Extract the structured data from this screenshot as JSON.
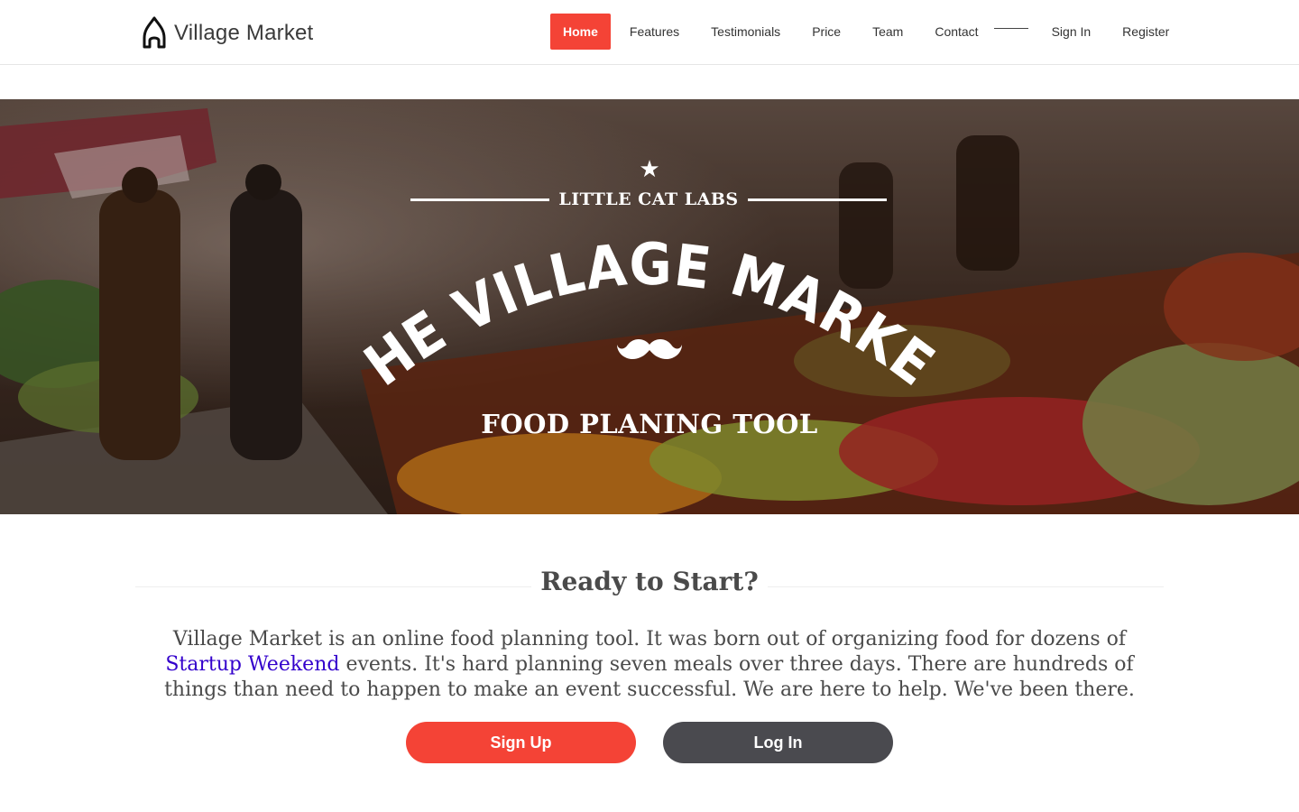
{
  "header": {
    "brand_name": "Village Market",
    "nav": [
      {
        "label": "Home",
        "active": true
      },
      {
        "label": "Features",
        "active": false
      },
      {
        "label": "Testimonials",
        "active": false
      },
      {
        "label": "Price",
        "active": false
      },
      {
        "label": "Team",
        "active": false
      },
      {
        "label": "Contact",
        "active": false
      }
    ],
    "auth": [
      {
        "label": "Sign In"
      },
      {
        "label": "Register"
      }
    ]
  },
  "hero": {
    "star_icon": "★",
    "kicker": "LITTLE CAT LABS",
    "title": "THE VILLAGE MARKET",
    "tagline": "FOOD PLANING TOOL",
    "mustache_icon": "mustache-icon",
    "background": "market-photo"
  },
  "ready": {
    "title": "Ready to Start?",
    "intro_before": "Village Market is an online food planning tool. It was born out of organizing food for dozens of ",
    "intro_link": "Startup Weekend",
    "intro_after": " events. It's hard planning seven meals over three days. There are hundreds of things than need to happen to make an event successful. We are here to help. We've been there.",
    "signup_label": "Sign Up",
    "login_label": "Log In"
  },
  "colors": {
    "accent": "#f44336",
    "dark_button": "#4a4a4f",
    "link": "#3300cc",
    "text": "#4a4a4a"
  }
}
